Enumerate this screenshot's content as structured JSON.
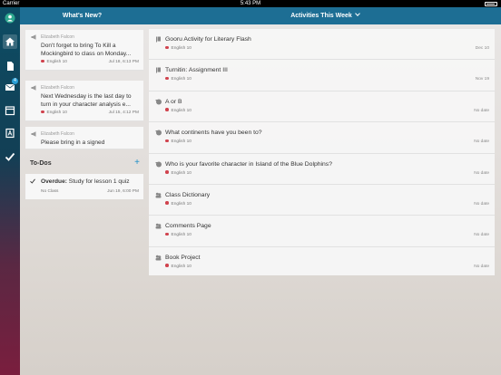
{
  "status_bar": {
    "carrier": "Carrier",
    "time": "5:43 PM"
  },
  "sidebar": {
    "items": [
      {
        "icon": "home-icon"
      },
      {
        "icon": "document-icon"
      },
      {
        "icon": "inbox-icon",
        "badge": "4"
      },
      {
        "icon": "calendar-icon"
      },
      {
        "icon": "grades-icon"
      },
      {
        "icon": "checkmark-icon"
      }
    ]
  },
  "header": {
    "left_title": "What's New?",
    "center_title": "Activities This Week"
  },
  "whats_new": [
    {
      "author": "Elizabeth Falcon",
      "message": "Don't forget to bring To Kill a Mockingbird to class on Monday...",
      "course": "English 10",
      "date": "Jul 18, 6:13 PM"
    },
    {
      "author": "Elizabeth Falcon",
      "message": "Next Wednesday is the last day to turn in your character analysis e...",
      "course": "English 10",
      "date": "Jul 15, 4:12 PM"
    },
    {
      "author": "Elizabeth Falcon",
      "message": "Please bring in a signed",
      "course": "",
      "date": ""
    }
  ],
  "todos": {
    "header": "To-Dos",
    "add_label": "+",
    "items": [
      {
        "prefix": "Overdue:",
        "title": "Study for lesson 1 quiz",
        "course": "No Class",
        "date": "Jun 19, 6:00 PM"
      }
    ]
  },
  "activities": [
    {
      "icon": "assignment-icon",
      "title": "Gooru Activity for Literary Flash",
      "course": "English 10",
      "date": "Dec 10"
    },
    {
      "icon": "assignment-icon",
      "title": "Turnitin: Assignment III",
      "course": "English 10",
      "date": "Nov 19"
    },
    {
      "icon": "quiz-icon",
      "title": "A or B",
      "course": "English 10",
      "date": "No date"
    },
    {
      "icon": "quiz-icon",
      "title": "What continents have you been to?",
      "course": "English 10",
      "date": "No date"
    },
    {
      "icon": "quiz-icon",
      "title": "Who is your favorite character in Island of the Blue Dolphins?",
      "course": "English 10",
      "date": "No date"
    },
    {
      "icon": "group-icon",
      "title": "Class Dictionary",
      "course": "English 10",
      "date": "No date"
    },
    {
      "icon": "group-icon",
      "title": "Comments Page",
      "course": "English 10",
      "date": "No date"
    },
    {
      "icon": "group-icon",
      "title": "Book Project",
      "course": "English 10",
      "date": "No date"
    }
  ],
  "colors": {
    "header": "#1d6e94",
    "course_dot": "#d0424d",
    "accent": "#1d8fc7"
  }
}
